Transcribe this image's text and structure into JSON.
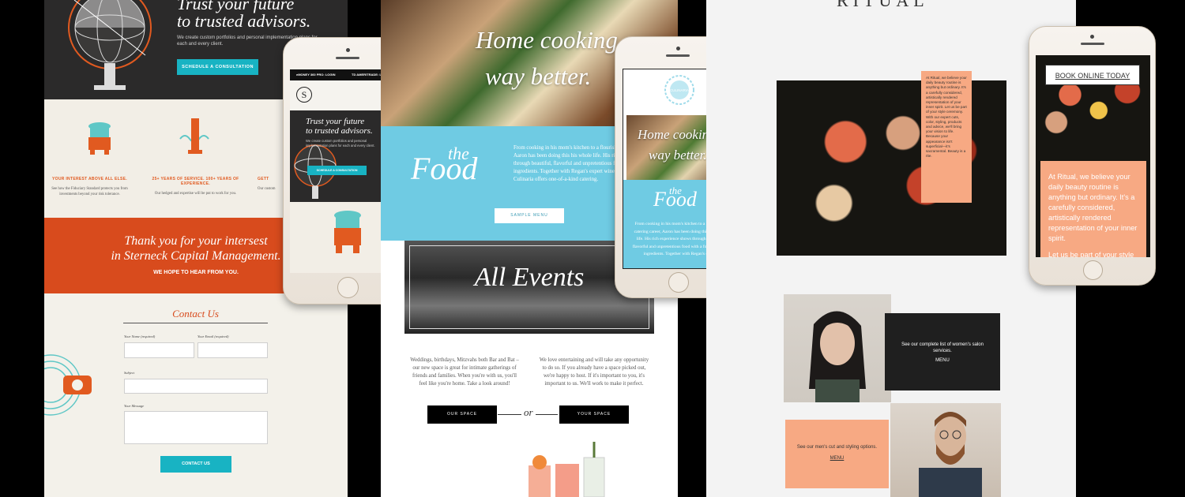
{
  "panel1": {
    "hero_title_line1": "Trust your future",
    "hero_title_line2": "to trusted advisors.",
    "hero_subtitle": "We create custom portfolios and personal implementation plans for each and every client.",
    "cta_label": "SCHEDULE A CONSULTATION",
    "features": [
      {
        "heading": "YOUR INTEREST ABOVE ALL ELSE.",
        "body": "See how the Fiduciary Standard protects you from investments beyond your risk tolerance."
      },
      {
        "heading": "25+ YEARS OF SERVICE. 100+ YEARS OF EXPERIENCE.",
        "body": "Our hedged and expertise will be put to work for you."
      },
      {
        "heading": "GETT",
        "body": "Our custom"
      }
    ],
    "thanks_line1": "Thank you for your intersest",
    "thanks_line2": "in Sterneck Capital Management.",
    "thanks_sub": "WE HOPE TO HEAR FROM YOU.",
    "contact_title": "Contact Us",
    "form": {
      "name_label": "Your Name (required)",
      "email_label": "Your Email (required)",
      "subject_label": "Subject",
      "message_label": "Your Message",
      "submit_label": "CONTACT US"
    }
  },
  "phone1": {
    "nav_left": "eMONEY 360 PRO: LOGIN",
    "nav_right": "TD AMERITRADE: LOGIN",
    "logo_letter": "S",
    "hero_line1": "Trust your future",
    "hero_line2": "to trusted advisors.",
    "hero_sub": "We create custom portfolios and personal implementation plans for each and every client.",
    "cta_label": "SCHEDULE A CONSULTATION"
  },
  "panel2": {
    "hero_line1": "Home cooking,",
    "hero_line2": "way better.",
    "the": "the",
    "food": "Food",
    "food_body": "From cooking in his mom's kitchen to a flourishing catering career, Aaron has been doing this his whole life. His rich experience shows through beautiful, flavorful and unpretentious food with a focus on local ingredients. Together with Regan's expert wine and cocktail service, Culinaria offers one-of-a-kind catering.",
    "menu_btn": "SAMPLE MENU",
    "events_title": "All Events",
    "col_left": "Weddings, birthdays, Mitzvahs both Bar and Bat – our new space is great for intimate gatherings of friends and families. When you're with us, you'll feel like you're home. Take a look around!",
    "col_right": "We love entertaining and will take any opportunity to do so. If you already have a space picked out, we're happy to host. If it's important to you, it's important to us. We'll work to make it perfect.",
    "btn_left": "OUR SPACE",
    "or": "or",
    "btn_right": "YOUR SPACE"
  },
  "phone2": {
    "logo_text": "CULINARIA",
    "hero_line1": "Home cooking,",
    "hero_line2": "way better.",
    "the": "the",
    "food": "Food",
    "body": "From cooking in his mom's kitchen to a flourishing catering career, Aaron has been doing this his whole life. His rich experience shows through beautiful, flavorful and unpretentious food with a focus on local ingredients. Together with Regan's expert"
  },
  "panel3": {
    "logo": "RITUAL",
    "callout": "At Ritual, we believe your daily beauty routine is anything but ordinary. It's a carefully considered, artistically rendered representation of your inner spirit. Let us be part of your style ceremony. With our expert cuts, color, styling, products and advice, we'll bring your vision to life. Because your appearance isn't superficial—it's sacramental. Beauty is a rite.",
    "women_text": "See our complete list of women's salon services.",
    "women_link": "MENU",
    "men_text": "See our men's cut and styling options.",
    "men_link": "MENU"
  },
  "phone3": {
    "book_btn": "BOOK ONLINE TODAY",
    "body1": "At Ritual, we believe your daily beauty routine is anything but ordinary. It's a carefully considered, artistically rendered representation of your inner spirit.",
    "body2": "Let us be part of your style ceremony. With our expert cuts, color, styling, products"
  },
  "colors": {
    "teal": "#18b3c3",
    "orange": "#d84b1d",
    "sky": "#6fcbe3",
    "peach": "#f7a983"
  }
}
